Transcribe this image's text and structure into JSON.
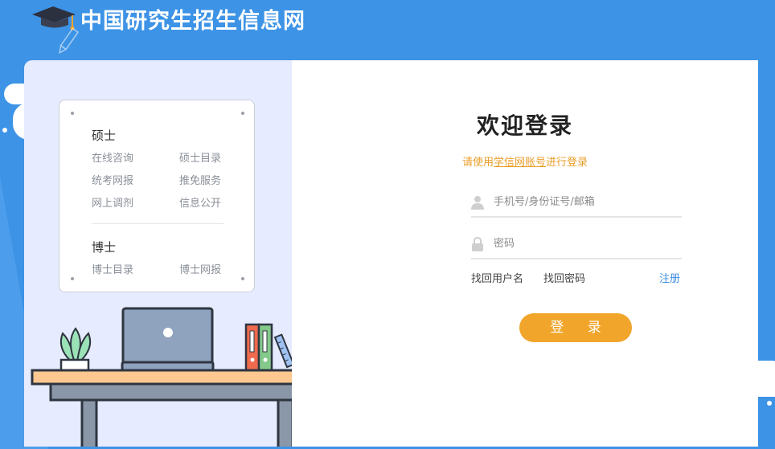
{
  "header": {
    "site_title": "中国研究生招生信息网",
    "logo_icon": "graduation-cap-icon"
  },
  "menu": {
    "master": {
      "heading": "硕士",
      "links": [
        "在线咨询",
        "硕士目录",
        "统考网报",
        "推免服务",
        "网上调剂",
        "信息公开"
      ]
    },
    "doctor": {
      "heading": "博士",
      "links": [
        "博士目录",
        "博士网报"
      ]
    }
  },
  "login": {
    "title": "欢迎登录",
    "subtitle_prefix": "请使用",
    "subtitle_link": "学信网账号",
    "subtitle_suffix": "进行登录",
    "username_placeholder": "手机号/身份证号/邮箱",
    "password_placeholder": "密码",
    "find_username": "找回用户名",
    "find_password": "找回密码",
    "register": "注册",
    "submit": "登 录"
  },
  "colors": {
    "background": "#3d93e6",
    "panel_left": "#e6ebff",
    "accent_orange": "#f1a52b",
    "link_blue": "#3d8ee0"
  }
}
